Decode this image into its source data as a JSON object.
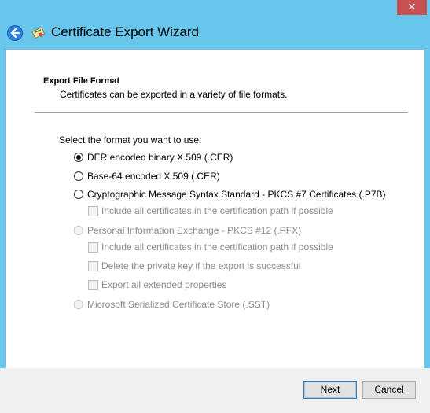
{
  "window": {
    "close_glyph": "✕",
    "title": "Certificate Export Wizard",
    "back_icon": "back-arrow-icon",
    "app_icon": "certificate-icon"
  },
  "header": {
    "section_title": "Export File Format",
    "section_desc": "Certificates can be exported in a variety of file formats."
  },
  "form": {
    "prompt": "Select the format you want to use:",
    "options": [
      {
        "label": "DER encoded binary X.509 (.CER)",
        "type": "radio",
        "checked": true,
        "enabled": true
      },
      {
        "label": "Base-64 encoded X.509 (.CER)",
        "type": "radio",
        "checked": false,
        "enabled": true
      },
      {
        "label": "Cryptographic Message Syntax Standard - PKCS #7 Certificates (.P7B)",
        "type": "radio",
        "checked": false,
        "enabled": true
      },
      {
        "label": "Include all certificates in the certification path if possible",
        "type": "checkbox",
        "checked": false,
        "enabled": false
      },
      {
        "label": "Personal Information Exchange - PKCS #12 (.PFX)",
        "type": "radio",
        "checked": false,
        "enabled": false
      },
      {
        "label": "Include all certificates in the certification path if possible",
        "type": "checkbox",
        "checked": false,
        "enabled": false
      },
      {
        "label": "Delete the private key if the export is successful",
        "type": "checkbox",
        "checked": false,
        "enabled": false
      },
      {
        "label": "Export all extended properties",
        "type": "checkbox",
        "checked": false,
        "enabled": false
      },
      {
        "label": "Microsoft Serialized Certificate Store (.SST)",
        "type": "radio",
        "checked": false,
        "enabled": false
      }
    ]
  },
  "footer": {
    "next_label": "Next",
    "cancel_label": "Cancel"
  },
  "colors": {
    "window_frame": "#68c6ec",
    "close_button": "#c75050",
    "disabled_text": "#8a8a8a"
  }
}
